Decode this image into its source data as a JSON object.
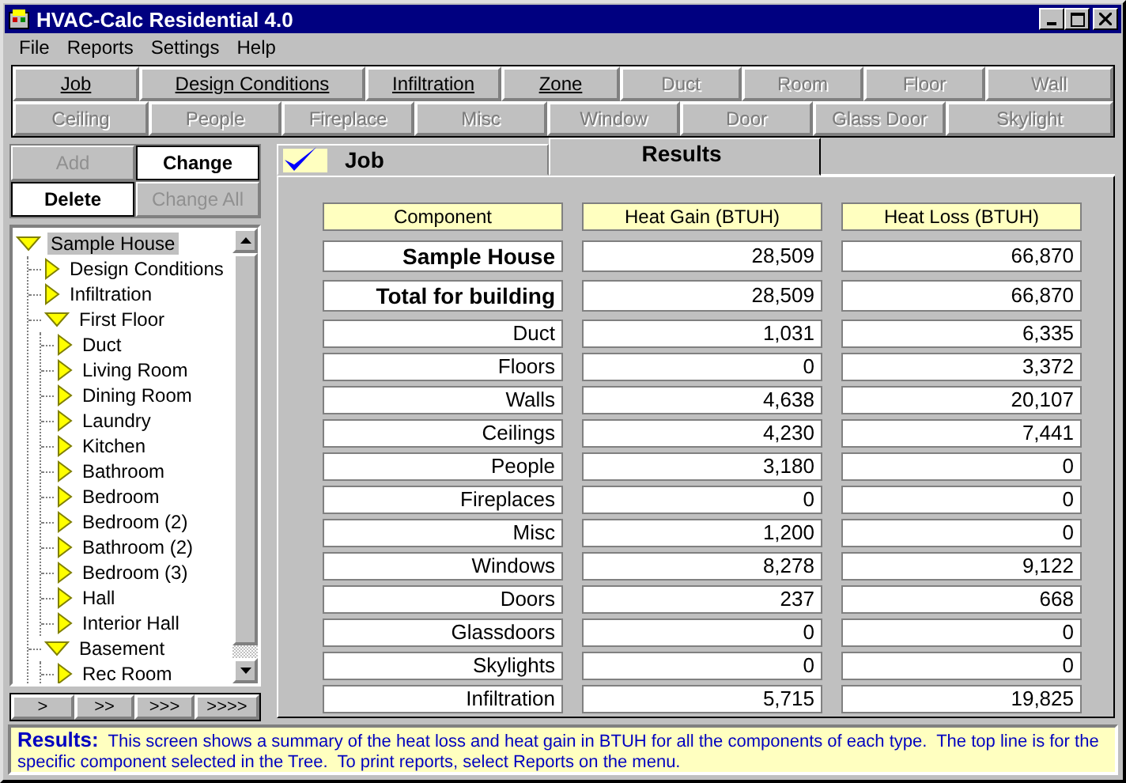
{
  "window": {
    "title": "HVAC-Calc Residential 4.0"
  },
  "menu": [
    "File",
    "Reports",
    "Settings",
    "Help"
  ],
  "toolbar": [
    {
      "label": "Job",
      "disabled": false
    },
    {
      "label": "Design Conditions",
      "disabled": false
    },
    {
      "label": "Infiltration",
      "disabled": false
    },
    {
      "label": "Zone",
      "disabled": false
    },
    {
      "label": "Duct",
      "disabled": true
    },
    {
      "label": "Room",
      "disabled": true
    },
    {
      "label": "Floor",
      "disabled": true
    },
    {
      "label": "Wall",
      "disabled": true
    },
    {
      "label": "Ceiling",
      "disabled": true
    },
    {
      "label": "People",
      "disabled": true
    },
    {
      "label": "Fireplace",
      "disabled": true
    },
    {
      "label": "Misc",
      "disabled": true
    },
    {
      "label": "Window",
      "disabled": true
    },
    {
      "label": "Door",
      "disabled": true
    },
    {
      "label": "Glass Door",
      "disabled": true
    },
    {
      "label": "Skylight",
      "disabled": true
    }
  ],
  "edit_buttons": [
    {
      "label": "Add",
      "disabled": true
    },
    {
      "label": "Change",
      "disabled": false
    },
    {
      "label": "Delete",
      "disabled": false
    },
    {
      "label": "Change All",
      "disabled": true
    }
  ],
  "tree": [
    {
      "label": "Sample House",
      "selected": true,
      "expanded": true,
      "children": [
        {
          "label": "Design Conditions",
          "selected": false,
          "expanded": false
        },
        {
          "label": "Infiltration",
          "selected": false,
          "expanded": false
        },
        {
          "label": "First Floor",
          "selected": false,
          "expanded": true,
          "children": [
            {
              "label": "Duct",
              "selected": false,
              "expanded": false
            },
            {
              "label": "Living Room",
              "selected": false,
              "expanded": false
            },
            {
              "label": "Dining Room",
              "selected": false,
              "expanded": false
            },
            {
              "label": "Laundry",
              "selected": false,
              "expanded": false
            },
            {
              "label": "Kitchen",
              "selected": false,
              "expanded": false
            },
            {
              "label": "Bathroom",
              "selected": false,
              "expanded": false
            },
            {
              "label": "Bedroom",
              "selected": false,
              "expanded": false
            },
            {
              "label": "Bedroom (2)",
              "selected": false,
              "expanded": false
            },
            {
              "label": "Bathroom (2)",
              "selected": false,
              "expanded": false
            },
            {
              "label": "Bedroom (3)",
              "selected": false,
              "expanded": false
            },
            {
              "label": "Hall",
              "selected": false,
              "expanded": false
            },
            {
              "label": "Interior Hall",
              "selected": false,
              "expanded": false
            }
          ]
        },
        {
          "label": "Basement",
          "selected": false,
          "expanded": true,
          "children": [
            {
              "label": "Rec Room",
              "selected": false,
              "expanded": false
            }
          ]
        }
      ]
    }
  ],
  "nav_buttons": [
    ">",
    ">>",
    ">>>",
    ">>>>"
  ],
  "tabs": [
    {
      "label": "Job",
      "selected": false,
      "checked": true
    },
    {
      "label": "Results",
      "selected": true,
      "checked": false
    }
  ],
  "results": {
    "columns": [
      "Component",
      "Heat Gain (BTUH)",
      "Heat Loss (BTUH)"
    ],
    "rows": [
      {
        "kind": "total",
        "component": "Sample House",
        "heat_gain": "28,509",
        "heat_loss": "66,870"
      },
      {
        "kind": "total",
        "component": "Total for building",
        "heat_gain": "28,509",
        "heat_loss": "66,870"
      },
      {
        "kind": "item",
        "component": "Duct",
        "heat_gain": "1,031",
        "heat_loss": "6,335"
      },
      {
        "kind": "item",
        "component": "Floors",
        "heat_gain": "0",
        "heat_loss": "3,372"
      },
      {
        "kind": "item",
        "component": "Walls",
        "heat_gain": "4,638",
        "heat_loss": "20,107"
      },
      {
        "kind": "item",
        "component": "Ceilings",
        "heat_gain": "4,230",
        "heat_loss": "7,441"
      },
      {
        "kind": "item",
        "component": "People",
        "heat_gain": "3,180",
        "heat_loss": "0"
      },
      {
        "kind": "item",
        "component": "Fireplaces",
        "heat_gain": "0",
        "heat_loss": "0"
      },
      {
        "kind": "item",
        "component": "Misc",
        "heat_gain": "1,200",
        "heat_loss": "0"
      },
      {
        "kind": "item",
        "component": "Windows",
        "heat_gain": "8,278",
        "heat_loss": "9,122"
      },
      {
        "kind": "item",
        "component": "Doors",
        "heat_gain": "237",
        "heat_loss": "668"
      },
      {
        "kind": "item",
        "component": "Glassdoors",
        "heat_gain": "0",
        "heat_loss": "0"
      },
      {
        "kind": "item",
        "component": "Skylights",
        "heat_gain": "0",
        "heat_loss": "0"
      },
      {
        "kind": "item",
        "component": "Infiltration",
        "heat_gain": "5,715",
        "heat_loss": "19,825"
      }
    ]
  },
  "status": {
    "label": "Results:",
    "text": "This screen shows a summary of the heat loss and heat gain in BTUH for all the components of each type.  The top line is for the specific component selected in the Tree.  To print reports, select Reports on the menu."
  }
}
